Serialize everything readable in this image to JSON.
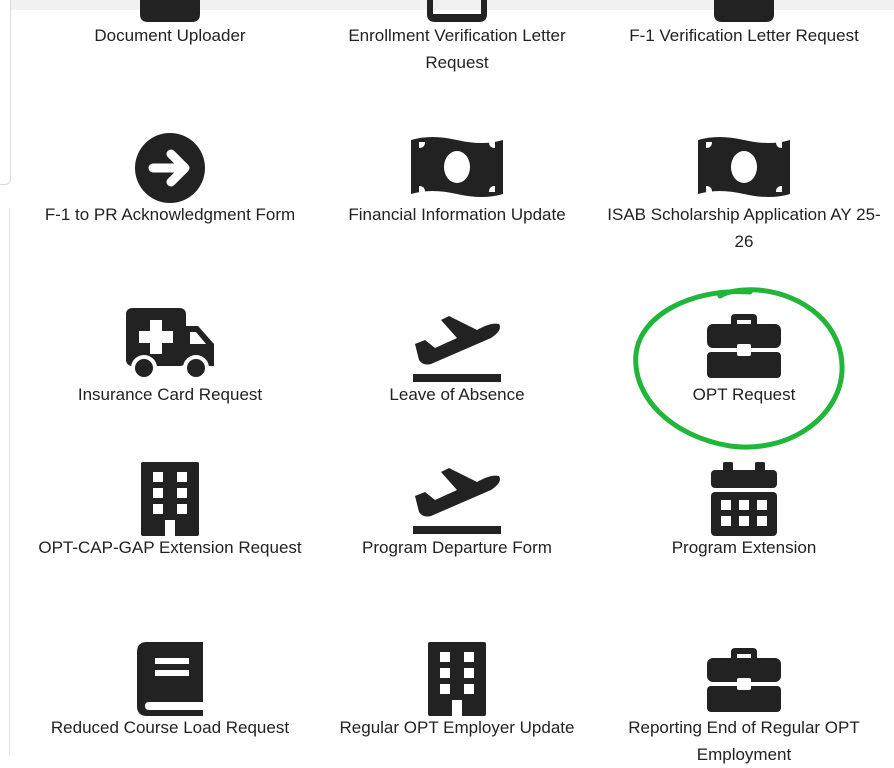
{
  "tiles": [
    {
      "label": "Document Uploader",
      "icon": "upload-icon"
    },
    {
      "label": "Enrollment Verification Letter Request",
      "icon": "letter-icon"
    },
    {
      "label": "F-1 Verification Letter Request",
      "icon": "letter-icon"
    },
    {
      "label": "F-1 to PR Acknowledgment Form",
      "icon": "arrow-right-icon"
    },
    {
      "label": "Financial Information Update",
      "icon": "money-icon"
    },
    {
      "label": "ISAB Scholarship Application AY 25-26",
      "icon": "money-icon"
    },
    {
      "label": "Insurance Card Request",
      "icon": "ambulance-icon"
    },
    {
      "label": "Leave of Absence",
      "icon": "plane-departure-icon"
    },
    {
      "label": "OPT Request",
      "icon": "briefcase-icon"
    },
    {
      "label": "OPT-CAP-GAP Extension Request",
      "icon": "building-icon"
    },
    {
      "label": "Program Departure Form",
      "icon": "plane-departure-icon"
    },
    {
      "label": "Program Extension",
      "icon": "calendar-icon"
    },
    {
      "label": "Reduced Course Load Request",
      "icon": "book-icon"
    },
    {
      "label": "Regular OPT Employer Update",
      "icon": "building-icon"
    },
    {
      "label": "Reporting End of Regular OPT Employment",
      "icon": "briefcase-icon"
    }
  ],
  "colors": {
    "icon": "#222222",
    "annotation": "#21b53a"
  }
}
